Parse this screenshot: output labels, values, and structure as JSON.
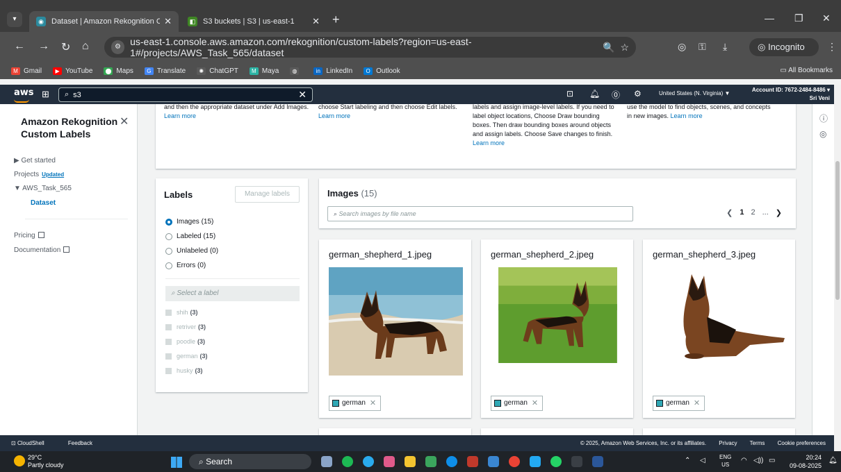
{
  "browser": {
    "tabs": [
      {
        "title": "Dataset | Amazon Rekognition Custo"
      },
      {
        "title": "S3 buckets | S3 | us-east-1"
      }
    ],
    "url": "us-east-1.console.aws.amazon.com/rekognition/custom-labels?region=us-east-1#/projects/AWS_Task_565/dataset",
    "incognito_label": "Incognito",
    "bookmarks": [
      "Gmail",
      "YouTube",
      "Maps",
      "Translate",
      "ChatGPT",
      "Maya",
      "LinkedIn",
      "Outlook"
    ],
    "all_bookmarks": "All Bookmarks"
  },
  "aws_nav": {
    "logo": "aws",
    "search_value": "s3",
    "region": "United States (N. Virginia) ▼",
    "account_id": "Account ID: 7672-2484-8486 ▾",
    "user": "Sri Veni"
  },
  "sidenav": {
    "title": "Amazon Rekognition Custom Labels",
    "items": [
      {
        "label": "▶ Get started"
      },
      {
        "label": "Projects",
        "badge": "Updated"
      },
      {
        "label": "▼ AWS_Task_565"
      },
      {
        "label": "Dataset"
      },
      {
        "label": "Pricing"
      },
      {
        "label": "Documentation"
      }
    ]
  },
  "info": {
    "col1": "and then the appropriate dataset under Add Images.",
    "col2": "choose Start labeling and then choose Edit labels.",
    "col3": "labels and assign image-level labels. If you need to label object locations, Choose Draw bounding boxes. Then draw bounding boxes around objects and assign labels. Choose Save changes to finish.",
    "col4": "use the model to find objects, scenes, and concepts in new images.",
    "learn_more": "Learn more"
  },
  "labels_panel": {
    "title": "Labels",
    "manage_button": "Manage labels",
    "filters": [
      "Images (15)",
      "Labeled (15)",
      "Unlabeled (0)",
      "Errors (0)"
    ],
    "select_placeholder": "Select a label",
    "labels": [
      {
        "name": "shih",
        "count": "(3)"
      },
      {
        "name": "retriver",
        "count": "(3)"
      },
      {
        "name": "poodle",
        "count": "(3)"
      },
      {
        "name": "german",
        "count": "(3)"
      },
      {
        "name": "husky",
        "count": "(3)"
      }
    ]
  },
  "images_panel": {
    "title": "Images",
    "count": "(15)",
    "search_placeholder": "Search images by file name",
    "pages": [
      "1",
      "2",
      "..."
    ]
  },
  "images": [
    {
      "file": "german_shepherd_1.jpeg",
      "label": "german"
    },
    {
      "file": "german_shepherd_2.jpeg",
      "label": "german"
    },
    {
      "file": "german_shepherd_3.jpeg",
      "label": "german"
    }
  ],
  "footer": {
    "cloudshell": "CloudShell",
    "feedback": "Feedback",
    "copyright": "© 2025, Amazon Web Services, Inc. or its affiliates.",
    "privacy": "Privacy",
    "terms": "Terms",
    "cookies": "Cookie preferences"
  },
  "taskbar": {
    "temp": "29°C",
    "weather": "Partly cloudy",
    "search": "Search",
    "lang": "ENG",
    "lang2": "US",
    "time": "20:24",
    "date": "09-08-2025"
  },
  "colors": {
    "aws_nav": "#232f3e",
    "link": "#0073bb",
    "label_swatch": "#2fa8b5"
  }
}
